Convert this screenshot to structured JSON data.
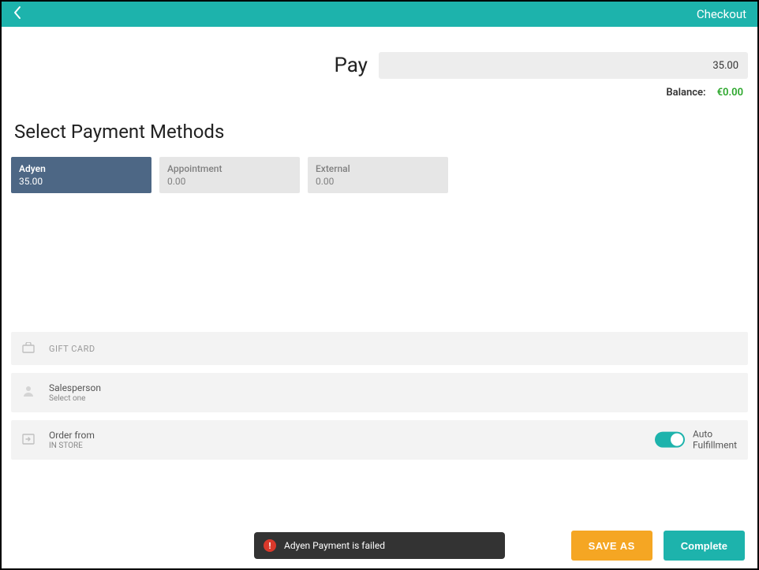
{
  "header": {
    "title": "Checkout"
  },
  "pay": {
    "label": "Pay",
    "amount": "35.00"
  },
  "balance": {
    "label": "Balance:",
    "amount": "€0.00"
  },
  "section_title": "Select Payment Methods",
  "methods": [
    {
      "name": "Adyen",
      "amount": "35.00",
      "selected": true
    },
    {
      "name": "Appointment",
      "amount": "0.00",
      "selected": false
    },
    {
      "name": "External",
      "amount": "0.00",
      "selected": false
    }
  ],
  "gift_card": {
    "label": "GIFT CARD"
  },
  "salesperson": {
    "label": "Salesperson",
    "sub": "Select one"
  },
  "order_from": {
    "label": "Order from",
    "sub": "IN STORE"
  },
  "auto_fulfillment": {
    "label_line1": "Auto",
    "label_line2": "Fulfillment",
    "enabled": true
  },
  "toast": {
    "message": "Adyen Payment is failed"
  },
  "actions": {
    "save": "SAVE AS",
    "complete": "Complete"
  }
}
